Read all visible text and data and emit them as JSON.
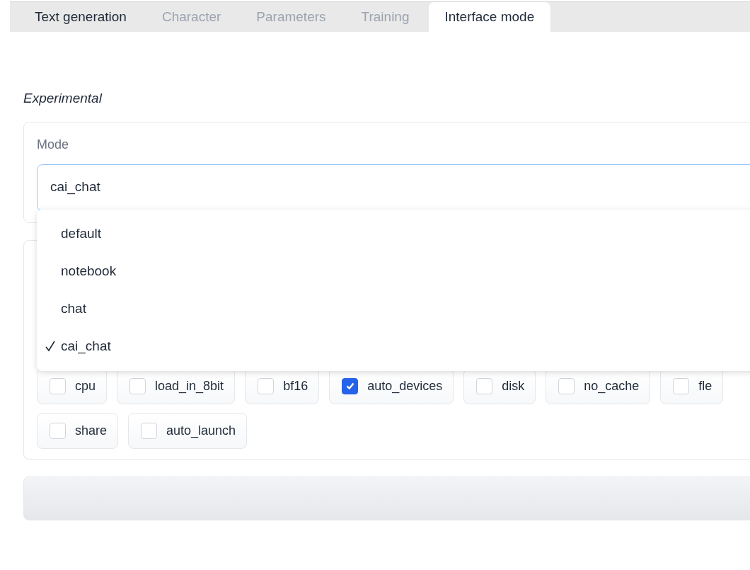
{
  "tabs": [
    {
      "label": "Text generation",
      "selected": false,
      "disabled": false
    },
    {
      "label": "Character",
      "selected": false,
      "disabled": true
    },
    {
      "label": "Parameters",
      "selected": false,
      "disabled": true
    },
    {
      "label": "Training",
      "selected": false,
      "disabled": true
    },
    {
      "label": "Interface mode",
      "selected": true,
      "disabled": false
    }
  ],
  "section_title": "Experimental",
  "mode": {
    "label": "Mode",
    "value": "cai_chat",
    "expanded": true,
    "options": [
      {
        "label": "default",
        "selected": false
      },
      {
        "label": "notebook",
        "selected": false
      },
      {
        "label": "chat",
        "selected": false
      },
      {
        "label": "cai_chat",
        "selected": true
      }
    ]
  },
  "flags": [
    {
      "label": "cpu",
      "checked": false
    },
    {
      "label": "load_in_8bit",
      "checked": false
    },
    {
      "label": "bf16",
      "checked": false
    },
    {
      "label": "auto_devices",
      "checked": true
    },
    {
      "label": "disk",
      "checked": false
    },
    {
      "label": "no_cache",
      "checked": false
    },
    {
      "label": "fle",
      "checked": false
    },
    {
      "label": "share",
      "checked": false
    },
    {
      "label": "auto_launch",
      "checked": false
    }
  ]
}
